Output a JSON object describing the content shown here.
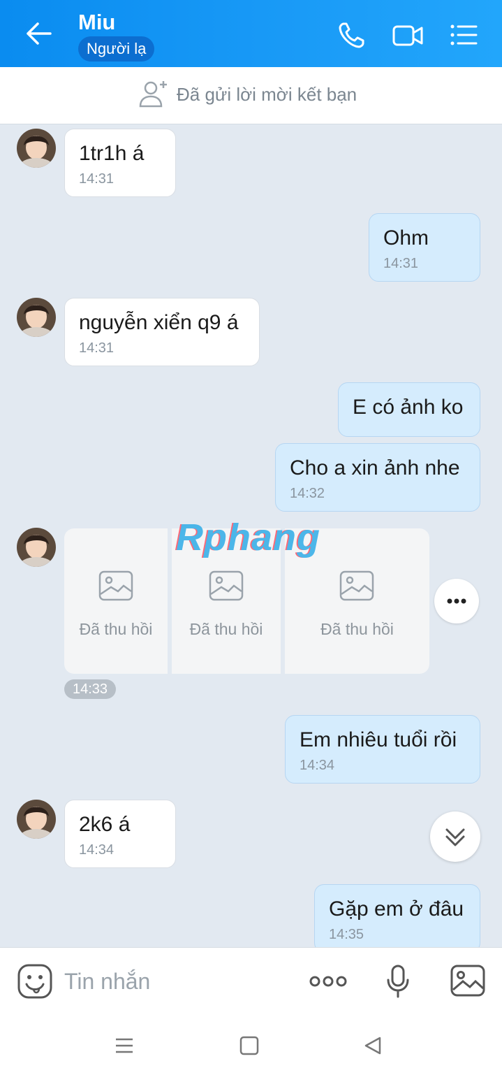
{
  "header": {
    "contact_name": "Miu",
    "badge": "Người lạ",
    "icons": [
      "back-arrow-icon",
      "phone-icon",
      "video-call-icon",
      "menu-list-icon"
    ]
  },
  "friend_request": {
    "text": "Đã gửi lời mời kết bạn",
    "icon": "add-friend-icon"
  },
  "messages": [
    {
      "side": "in",
      "text": "1tr1h á",
      "time": "14:31"
    },
    {
      "side": "out",
      "text": "Ohm",
      "time": "14:31"
    },
    {
      "side": "in",
      "text": "nguyễn xiển q9 á",
      "time": "14:31"
    },
    {
      "side": "out",
      "text": "E có ảnh ko",
      "time": ""
    },
    {
      "side": "out",
      "text": "Cho a xin ảnh nhe",
      "time": "14:32"
    },
    {
      "side": "out",
      "text": "Em nhiêu tuổi rồi",
      "time": "14:34"
    },
    {
      "side": "in",
      "text": "2k6 á",
      "time": "14:34"
    },
    {
      "side": "out",
      "text": "Gặp em ở đâu",
      "time": "14:35"
    }
  ],
  "recalled_photos": {
    "items": [
      "Đã thu hồi",
      "Đã thu hồi",
      "Đã thu hồi"
    ],
    "time": "14:33"
  },
  "watermark": "Rphang",
  "composer": {
    "placeholder": "Tin nhắn"
  },
  "colors": {
    "header_blue": "#0a8cf0",
    "outgoing_bubble": "#d5ecfd",
    "chat_background": "#e2e9f1"
  }
}
